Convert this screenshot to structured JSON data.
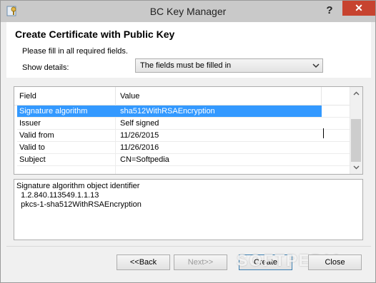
{
  "window": {
    "title": "BC Key Manager",
    "help": "?",
    "close": "✕"
  },
  "header": {
    "title": "Create Certificate with Public Key",
    "subtitle": "Please fill in all required fields.",
    "show_details_label": "Show details:",
    "show_details_value": "The fields must be filled in"
  },
  "grid": {
    "columns": [
      "Field",
      "Value"
    ],
    "rows": [
      {
        "field": "Signature algorithm",
        "value": "sha512WithRSAEncryption",
        "selected": true
      },
      {
        "field": "Issuer",
        "value": "Self signed"
      },
      {
        "field": "Valid from",
        "value": "11/26/2015"
      },
      {
        "field": "Valid to",
        "value": "11/26/2016"
      },
      {
        "field": "Subject",
        "value": "CN=Softpedia"
      }
    ]
  },
  "details": {
    "lines": [
      "Signature algorithm object identifier",
      "  1.2.840.113549.1.1.13",
      "  pkcs-1-sha512WithRSAEncryption"
    ]
  },
  "buttons": {
    "back": "<<Back",
    "next": "Next>>",
    "create": "Create",
    "close": "Close"
  },
  "watermark": "SOFTPEDIA",
  "colors": {
    "selection": "#3399ff",
    "close_button": "#c7432f"
  }
}
